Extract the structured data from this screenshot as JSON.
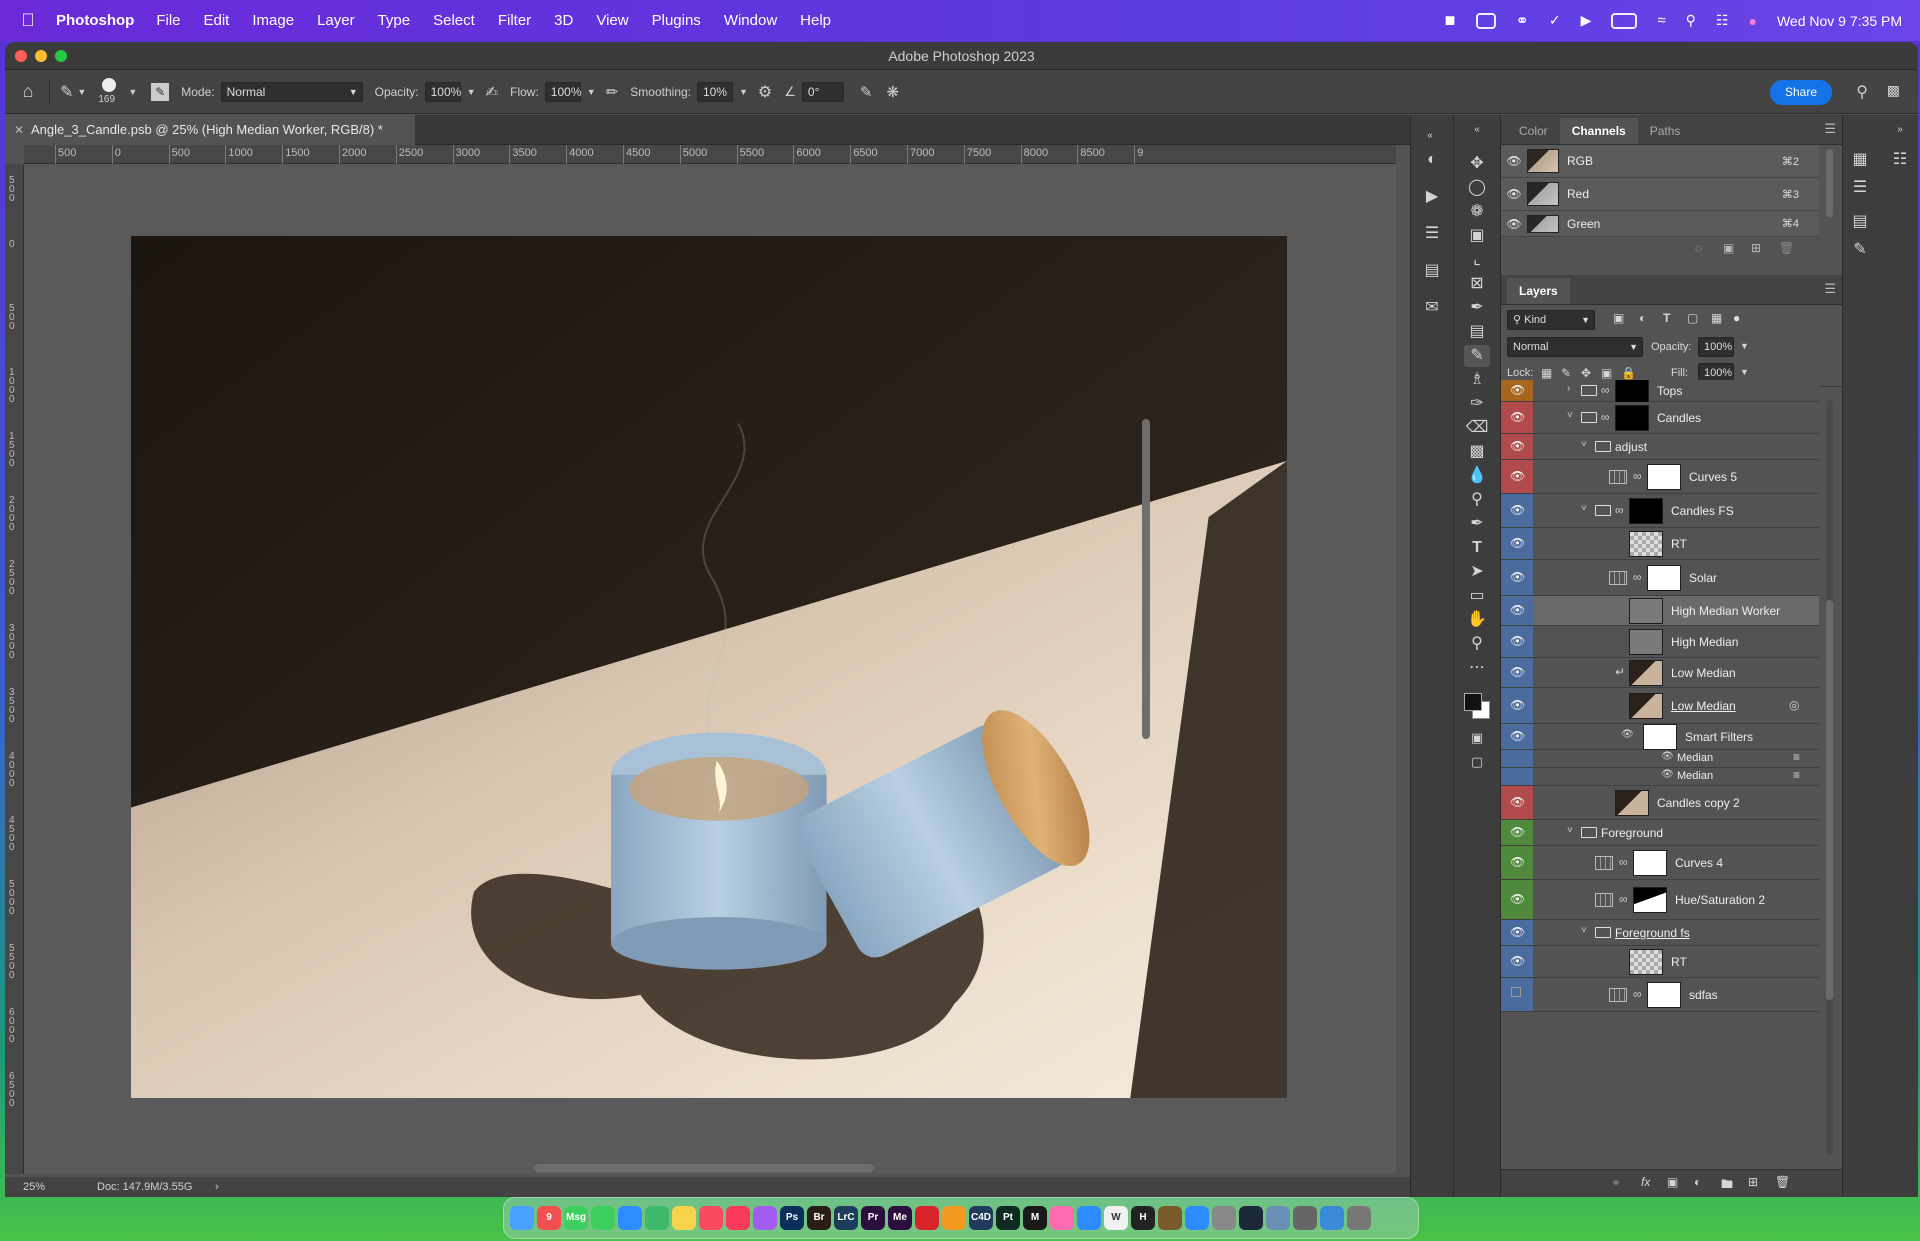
{
  "menubar": {
    "app_name": "Photoshop",
    "menus": [
      "File",
      "Edit",
      "Image",
      "Layer",
      "Type",
      "Select",
      "Filter",
      "3D",
      "View",
      "Plugins",
      "Window",
      "Help"
    ],
    "clock": "Wed Nov 9  7:35 PM"
  },
  "window": {
    "title": "Adobe Photoshop 2023"
  },
  "options_bar": {
    "brush_size": "169",
    "mode_label": "Mode:",
    "mode_value": "Normal",
    "opacity_label": "Opacity:",
    "opacity_value": "100%",
    "flow_label": "Flow:",
    "flow_value": "100%",
    "smoothing_label": "Smoothing:",
    "smoothing_value": "10%",
    "angle_value": "0°",
    "share_label": "Share"
  },
  "document": {
    "tab_title": "Angle_3_Candle.psb @ 25% (High Median Worker, RGB/8) *",
    "zoom": "25%",
    "doc_info": "Doc: 147.9M/3.55G"
  },
  "ruler": {
    "h_labels": [
      "500",
      "0",
      "500",
      "1000",
      "1500",
      "2000",
      "2500",
      "3000",
      "3500",
      "4000",
      "4500",
      "5000",
      "5500",
      "6000",
      "6500",
      "7000",
      "7500",
      "8000",
      "8500",
      "9"
    ],
    "v_labels": [
      "500",
      "0",
      "500",
      "1000",
      "1500",
      "2000",
      "2500",
      "3000",
      "3500",
      "4000",
      "4500",
      "5000",
      "5500",
      "6000",
      "6500"
    ]
  },
  "channels_panel": {
    "tabs": [
      "Color",
      "Channels",
      "Paths"
    ],
    "active_tab": "Channels",
    "channels": [
      {
        "name": "RGB",
        "shortcut": "⌘2"
      },
      {
        "name": "Red",
        "shortcut": "⌘3"
      },
      {
        "name": "Green",
        "shortcut": "⌘4"
      }
    ]
  },
  "layers_panel": {
    "title": "Layers",
    "filter_kind": "Kind",
    "blend_mode": "Normal",
    "opacity_label": "Opacity:",
    "opacity_value": "100%",
    "lock_label": "Lock:",
    "fill_label": "Fill:",
    "fill_value": "100%",
    "layers": [
      {
        "name": "Tops",
        "color": "#a8661c",
        "indent": 0
      },
      {
        "name": "Candles",
        "color": "#b14a4a",
        "indent": 0
      },
      {
        "name": "adjust",
        "color": "#b14a4a",
        "indent": 1
      },
      {
        "name": "Curves 5",
        "color": "#b14a4a",
        "indent": 2
      },
      {
        "name": "Candles FS",
        "color": "#4a6b9e",
        "indent": 1
      },
      {
        "name": "RT",
        "color": "#4a6b9e",
        "indent": 2
      },
      {
        "name": "Solar",
        "color": "#4a6b9e",
        "indent": 2
      },
      {
        "name": "High Median Worker",
        "color": "#4a6b9e",
        "indent": 2
      },
      {
        "name": "High Median",
        "color": "#4a6b9e",
        "indent": 2
      },
      {
        "name": "Low Median",
        "color": "#4a6b9e",
        "indent": 2
      },
      {
        "name": "Low Median",
        "color": "#4a6b9e",
        "indent": 2
      },
      {
        "name": "Smart Filters",
        "color": "#4a6b9e",
        "indent": 3
      },
      {
        "name": "Median",
        "color": "#4a6b9e",
        "indent": 4
      },
      {
        "name": "Median",
        "color": "#4a6b9e",
        "indent": 4
      },
      {
        "name": "Candles copy 2",
        "color": "#b14a4a",
        "indent": 1
      },
      {
        "name": "Foreground",
        "color": "#4f8a3c",
        "indent": 0
      },
      {
        "name": "Curves 4",
        "color": "#4f8a3c",
        "indent": 1
      },
      {
        "name": "Hue/Saturation 2",
        "color": "#4f8a3c",
        "indent": 1
      },
      {
        "name": "Foreground fs",
        "color": "#4a6b9e",
        "indent": 1
      },
      {
        "name": "RT",
        "color": "#4a6b9e",
        "indent": 2
      },
      {
        "name": "sdfas",
        "color": "#4a6b9e",
        "indent": 2
      }
    ]
  },
  "tools": [
    "move",
    "marquee",
    "lasso",
    "object-select",
    "crop",
    "frame",
    "eyedropper",
    "healing",
    "brush",
    "stamp",
    "history-brush",
    "eraser",
    "gradient",
    "blur",
    "dodge",
    "pen",
    "type",
    "path-select",
    "rectangle",
    "hand",
    "zoom",
    "more"
  ],
  "dock": {
    "apps": [
      "Finder",
      "9",
      "Msg",
      "FaceTime",
      "Safari",
      "Maps",
      "Notes",
      "Music",
      "News",
      "Podcasts",
      "Ps",
      "Br",
      "LrC",
      "Pr",
      "Me",
      "Acrobat",
      "Blender",
      "C4D",
      "Pt",
      "M",
      "Photos",
      "Mail",
      "W",
      "H",
      "Guitar",
      "Zoom",
      "Settings",
      "Steam",
      "Finder2",
      "Calc",
      "Preview",
      "Trash"
    ]
  }
}
